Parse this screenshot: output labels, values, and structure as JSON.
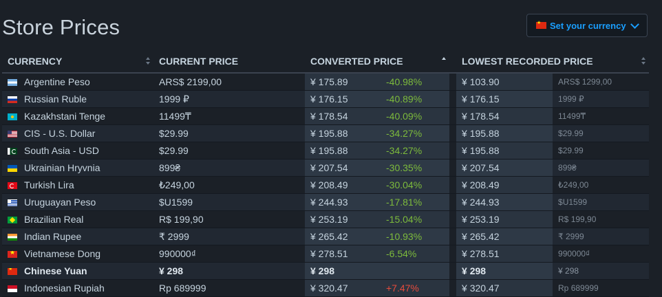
{
  "page_title": "Store Prices",
  "currency_selector": {
    "label": "Set your currency",
    "flag": "cn"
  },
  "columns": {
    "currency": "CURRENCY",
    "current_price": "CURRENT PRICE",
    "converted_price": "CONVERTED PRICE",
    "lowest_recorded_price": "LOWEST RECORDED PRICE"
  },
  "rows": [
    {
      "flag": "ar",
      "currency": "Argentine Peso",
      "current": "ARS$ 2199,00",
      "converted": "¥ 175.89",
      "pct": "-40.98%",
      "lowest": "¥ 103.90",
      "lowest_orig": "ARS$ 1299,00"
    },
    {
      "flag": "ru",
      "currency": "Russian Ruble",
      "current": "1999 ₽",
      "converted": "¥ 176.15",
      "pct": "-40.89%",
      "lowest": "¥ 176.15",
      "lowest_orig": "1999 ₽"
    },
    {
      "flag": "kz",
      "currency": "Kazakhstani Tenge",
      "current": "11499₸",
      "converted": "¥ 178.54",
      "pct": "-40.09%",
      "lowest": "¥ 178.54",
      "lowest_orig": "11499₸"
    },
    {
      "flag": "us",
      "currency": "CIS - U.S. Dollar",
      "current": "$29.99",
      "converted": "¥ 195.88",
      "pct": "-34.27%",
      "lowest": "¥ 195.88",
      "lowest_orig": "$29.99"
    },
    {
      "flag": "pk",
      "currency": "South Asia - USD",
      "current": "$29.99",
      "converted": "¥ 195.88",
      "pct": "-34.27%",
      "lowest": "¥ 195.88",
      "lowest_orig": "$29.99"
    },
    {
      "flag": "ua",
      "currency": "Ukrainian Hryvnia",
      "current": "899₴",
      "converted": "¥ 207.54",
      "pct": "-30.35%",
      "lowest": "¥ 207.54",
      "lowest_orig": "899₴"
    },
    {
      "flag": "tr",
      "currency": "Turkish Lira",
      "current": "₺249,00",
      "converted": "¥ 208.49",
      "pct": "-30.04%",
      "lowest": "¥ 208.49",
      "lowest_orig": "₺249,00"
    },
    {
      "flag": "uy",
      "currency": "Uruguayan Peso",
      "current": "$U1599",
      "converted": "¥ 244.93",
      "pct": "-17.81%",
      "lowest": "¥ 244.93",
      "lowest_orig": "$U1599"
    },
    {
      "flag": "br",
      "currency": "Brazilian Real",
      "current": "R$ 199,90",
      "converted": "¥ 253.19",
      "pct": "-15.04%",
      "lowest": "¥ 253.19",
      "lowest_orig": "R$ 199,90"
    },
    {
      "flag": "in",
      "currency": "Indian Rupee",
      "current": "₹ 2999",
      "converted": "¥ 265.42",
      "pct": "-10.93%",
      "lowest": "¥ 265.42",
      "lowest_orig": "₹ 2999"
    },
    {
      "flag": "vn",
      "currency": "Vietnamese Dong",
      "current": "990000₫",
      "converted": "¥ 278.51",
      "pct": "-6.54%",
      "lowest": "¥ 278.51",
      "lowest_orig": "990000₫"
    },
    {
      "flag": "cn",
      "currency": "Chinese Yuan",
      "current": "¥ 298",
      "converted": "¥ 298",
      "pct": "",
      "lowest": "¥ 298",
      "lowest_orig": "¥ 298",
      "highlight": true
    },
    {
      "flag": "id",
      "currency": "Indonesian Rupiah",
      "current": "Rp 689999",
      "converted": "¥ 320.47",
      "pct": "+7.47%",
      "lowest": "¥ 320.47",
      "lowest_orig": "Rp 689999"
    }
  ]
}
